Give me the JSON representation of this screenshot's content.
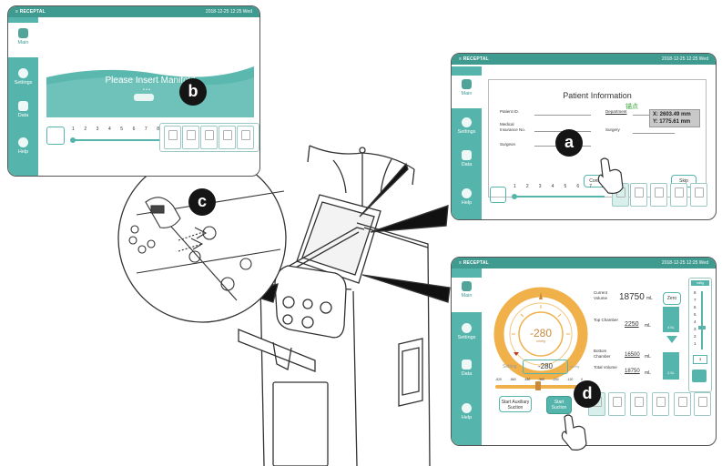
{
  "brand": "≡ RECEPTAL",
  "date": "2018-12-25",
  "time": "12:25",
  "day": "Wed",
  "nav": {
    "main": "Main",
    "settings": "Settings",
    "data": "Data",
    "help": "Help"
  },
  "panel_b": {
    "message": "Please Insert Manifold"
  },
  "panel_top_right": {
    "title": "Patient Information",
    "patient_id_label": "Patient ID.",
    "medical_insurance_label": "Medical Insurance No.",
    "surgeon_label": "Surgeon",
    "department_label": "Department",
    "surgery_label": "Surgery",
    "anchor_point": "锚点",
    "coord_x": "X: 2603.49 mm",
    "coord_y": "Y: 1775.61 mm",
    "confirm": "Confirm",
    "skip": "Skip"
  },
  "stepper_numbers": [
    "1",
    "2",
    "3",
    "4",
    "5",
    "6",
    "7",
    "8"
  ],
  "panel_d": {
    "gauge_value": "-280",
    "gauge_unit": "mmHg",
    "gauge_scale": [
      "-520",
      "-560",
      "-480",
      "-360",
      "-240",
      "-120",
      "0"
    ],
    "setting_label": "Setting",
    "setting_value": "-280",
    "setting_unit": "mmHg",
    "current_volume_label": "Current Volume",
    "current_volume_value": "18750",
    "unit_ml": "mL",
    "zero": "Zero",
    "top_chamber_label": "Top Chamber",
    "top_chamber_value": "2250",
    "bottom_chamber_label": "Bottom Chamber",
    "bottom_chamber_value": "16500",
    "total_volume_label": "Total Volume",
    "total_volume_value": "18750",
    "chamber_top_l": "4.5L",
    "chamber_bottom_l": "2.5L",
    "level_unit": "ml/kg",
    "level_numbers": [
      "8",
      "7",
      "6",
      "5",
      "4",
      "3",
      "2",
      "1"
    ],
    "level_value": "3",
    "start_auxiliary": "Start Auxiliary Suction",
    "start_suction": "Start Suction"
  },
  "badges": {
    "b": "b",
    "c": "c",
    "d": "d",
    "a": "a"
  }
}
